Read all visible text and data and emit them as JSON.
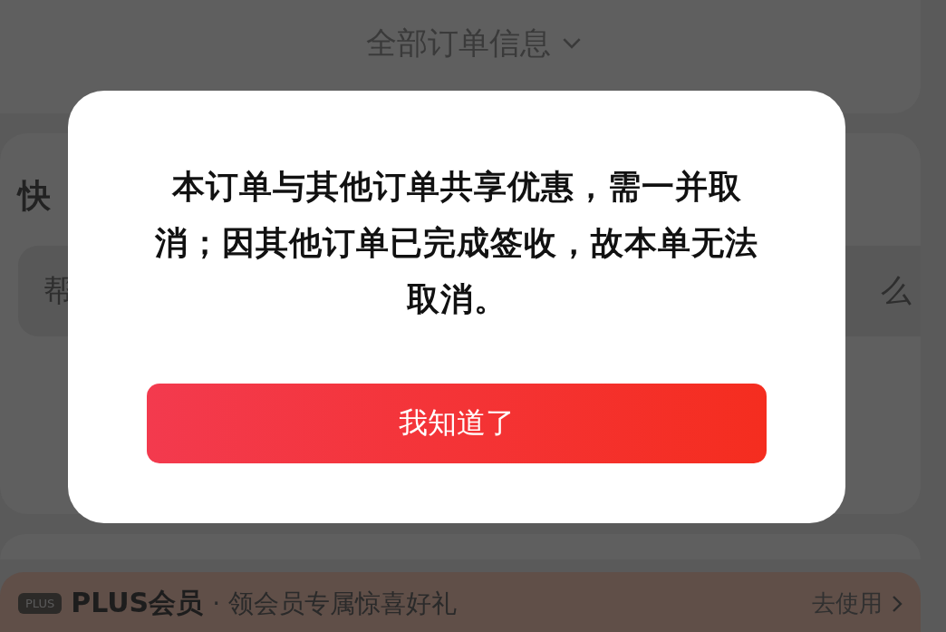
{
  "order_header": {
    "title": "全部订单信息"
  },
  "express_section": {
    "title": "快",
    "help_item": {
      "left_text": "帮",
      "right_text": "么"
    }
  },
  "plus_banner": {
    "badge": "PLUS",
    "title": "PLUS会员",
    "subtitle": "· 领会员专属惊喜好礼",
    "action": "去使用"
  },
  "dialog": {
    "message": "本订单与其他订单共享优惠，需一并取消；因其他订单已完成签收，故本单无法取消。",
    "button": "我知道了"
  }
}
